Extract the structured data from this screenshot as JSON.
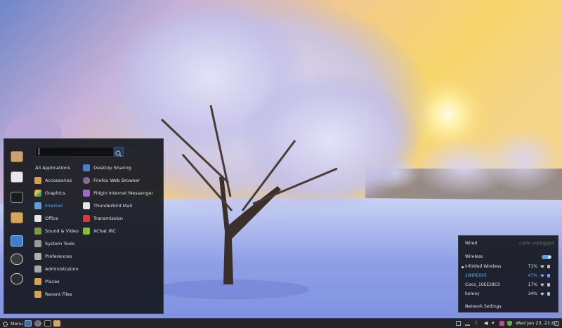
{
  "menu": {
    "search_value": "",
    "categories": [
      {
        "label": "All Applications"
      },
      {
        "label": "Accessories"
      },
      {
        "label": "Graphics"
      },
      {
        "label": "Internet"
      },
      {
        "label": "Office"
      },
      {
        "label": "Sound & Video"
      },
      {
        "label": "System Tools"
      },
      {
        "label": "Preferences"
      },
      {
        "label": "Administration"
      },
      {
        "label": "Places"
      },
      {
        "label": "Recent Files"
      }
    ],
    "active_category": "Internet",
    "apps": [
      {
        "label": "Desktop Sharing"
      },
      {
        "label": "Firefox Web Browser"
      },
      {
        "label": "Pidgin Internet Messenger"
      },
      {
        "label": "Thunderbird Mail"
      },
      {
        "label": "Transmission"
      },
      {
        "label": "XChat IRC"
      }
    ],
    "favorites": [
      "package-icon",
      "home-folder-icon",
      "terminal-icon",
      "files-icon",
      "display-settings-icon",
      "logout-icon",
      "shutdown-icon"
    ]
  },
  "network": {
    "wired_label": "Wired",
    "wired_status": "cable unplugged",
    "wireless_label": "Wireless",
    "wireless_enabled": true,
    "networks": [
      {
        "name": "Infolded Wireless",
        "strength": "71%",
        "connected": true,
        "selected": false
      },
      {
        "name": "2WIRE005",
        "strength": "47%",
        "connected": false,
        "selected": true
      },
      {
        "name": "Cisco_10EE28C0",
        "strength": "17%",
        "connected": false,
        "selected": false
      },
      {
        "name": "homey",
        "strength": "34%",
        "connected": false,
        "selected": false
      }
    ],
    "settings_label": "Network Settings"
  },
  "panel": {
    "menu_label": "Menu",
    "clock": "Wed Jan 23, 21:07"
  },
  "colors": {
    "accent": "#4fb0ff",
    "panel_bg": "#23252b",
    "menu_bg": "#16181e"
  }
}
